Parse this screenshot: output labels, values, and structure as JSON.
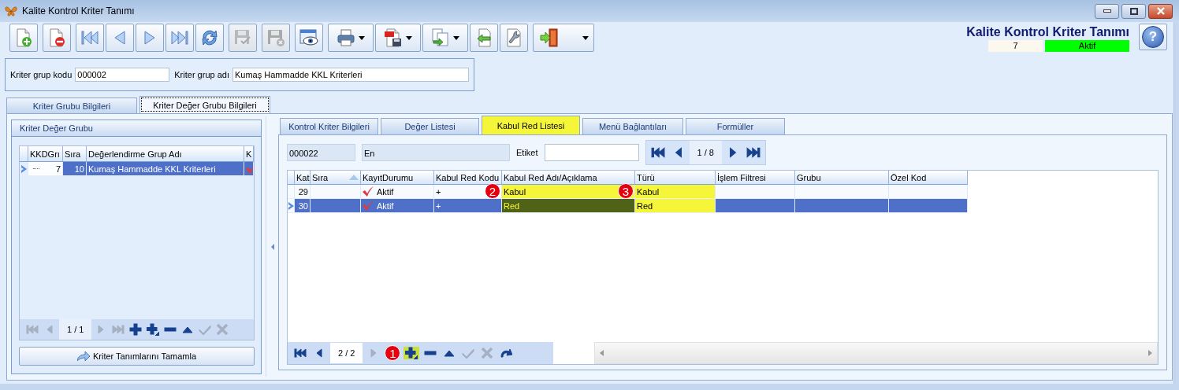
{
  "window": {
    "title": "Kalite Kontrol Kriter Tanımı"
  },
  "toolbar": [
    [
      {
        "kind": "new",
        "disabled": false,
        "has_menu": false
      }
    ],
    [
      {
        "kind": "delete",
        "disabled": false,
        "has_menu": false
      }
    ],
    [
      {
        "kind": "first",
        "disabled": false,
        "has_menu": false
      },
      {
        "kind": "prev",
        "disabled": false,
        "has_menu": false
      },
      {
        "kind": "next",
        "disabled": false,
        "has_menu": false
      },
      {
        "kind": "last",
        "disabled": false,
        "has_menu": false
      },
      {
        "kind": "refresh",
        "disabled": false,
        "has_menu": false
      }
    ],
    [
      {
        "kind": "save",
        "disabled": true,
        "has_menu": false
      }
    ],
    [
      {
        "kind": "cancel",
        "disabled": true,
        "has_menu": false
      }
    ],
    [
      {
        "kind": "preview",
        "disabled": false,
        "has_menu": false
      }
    ],
    [
      {
        "kind": "print",
        "disabled": false,
        "has_menu": true
      },
      {
        "kind": "pdf",
        "disabled": false,
        "has_menu": true
      },
      {
        "kind": "export",
        "disabled": false,
        "has_menu": true
      },
      {
        "kind": "import",
        "disabled": false,
        "has_menu": false
      },
      {
        "kind": "settings",
        "disabled": false,
        "has_menu": false
      }
    ],
    [
      {
        "kind": "exit",
        "disabled": false,
        "has_menu": true
      }
    ]
  ],
  "header": {
    "title": "Kalite Kontrol Kriter Tanımı",
    "record_no": "7",
    "status": "Aktif",
    "help_label": "?"
  },
  "form": [
    {
      "label": "Kriter grup kodu",
      "value": "000002"
    },
    {
      "label": "Kriter grup adı",
      "value": "Kumaş Hammadde KKL Kriterleri"
    }
  ],
  "main_tabs": [
    {
      "label": "Kriter Grubu Bilgileri",
      "selected": false
    },
    {
      "label": "Kriter Değer Grubu Bilgileri",
      "selected": true
    }
  ],
  "left_panel": {
    "title": "Kriter Değer Grubu",
    "grid": {
      "columns": [
        {
          "label": "KKDGrı"
        },
        {
          "label": "Sıra"
        },
        {
          "label": "Değerlendirme Grup Adı"
        },
        {
          "label": "K"
        }
      ],
      "rows": [
        {
          "selected": true,
          "cells": [
            {
              "text": "7",
              "kind": "lookup",
              "focused": true
            },
            {
              "text": "10",
              "kind": "number"
            },
            {
              "text": "Kumaş Hammadde KKL Kriterleri"
            },
            {
              "kind": "status",
              "checked": true
            }
          ]
        }
      ]
    },
    "navigator": {
      "position": "1 / 1",
      "buttons": [
        {
          "kind": "first",
          "disabled": true
        },
        {
          "kind": "prev",
          "disabled": true
        },
        {
          "kind": "pos"
        },
        {
          "kind": "next",
          "disabled": true
        },
        {
          "kind": "last",
          "disabled": true
        },
        {
          "kind": "add",
          "disabled": false
        },
        {
          "kind": "add-child",
          "disabled": false
        },
        {
          "kind": "remove",
          "disabled": false
        },
        {
          "kind": "up",
          "disabled": false
        },
        {
          "kind": "check",
          "disabled": true
        },
        {
          "kind": "cancel",
          "disabled": true
        }
      ]
    },
    "button": "Kriter Tanımlarını Tamamla"
  },
  "sub_tabs": [
    {
      "label": "Kontrol Kriter Bilgileri",
      "selected": false
    },
    {
      "label": "Değer Listesi",
      "selected": false
    },
    {
      "label": "Kabul Red Listesi",
      "selected": true
    },
    {
      "label": "Menü Bağlantıları",
      "selected": false
    },
    {
      "label": "Formüller",
      "selected": false
    }
  ],
  "detail": {
    "code": "000022",
    "name": "En",
    "tag_label": "Etiket",
    "record_position": "1 / 8",
    "grid": {
      "columns": [
        {
          "label": "Kat"
        },
        {
          "label": "Sıra",
          "sorted_ascending": true
        },
        {
          "label": "KayıtDurumu"
        },
        {
          "label": "Kabul Red Kodu"
        },
        {
          "label": "Kabul Red Adı/Açıklama"
        },
        {
          "label": "Türü"
        },
        {
          "label": "İşlem Filtresi"
        },
        {
          "label": "Grubu"
        },
        {
          "label": "Özel Kod"
        }
      ],
      "rows": [
        {
          "selected": false,
          "cells": [
            {
              "text": "29",
              "kind": "number"
            },
            {},
            {
              "text": "Aktif",
              "kind": "status",
              "checked": true
            },
            {
              "text": "+",
              "callout": "2"
            },
            {
              "text": "Kabul",
              "highlight": true,
              "callout": "3"
            },
            {
              "text": "Kabul",
              "highlight": true
            },
            {},
            {},
            {}
          ]
        },
        {
          "selected": true,
          "cells": [
            {
              "text": "30",
              "kind": "number"
            },
            {},
            {
              "text": "Aktif",
              "kind": "status",
              "checked": true
            },
            {
              "text": "+"
            },
            {
              "text": "Red",
              "highlight": true,
              "focused": true
            },
            {
              "text": "Red",
              "highlight": true
            },
            {},
            {},
            {}
          ]
        }
      ]
    },
    "navigator": {
      "position": "2 / 2",
      "buttons": [
        {
          "kind": "first",
          "disabled": false
        },
        {
          "kind": "prev",
          "disabled": false
        },
        {
          "kind": "pos"
        },
        {
          "kind": "next",
          "disabled": true
        },
        {
          "kind": "add-child",
          "disabled": false,
          "highlight": true,
          "callout": "1"
        },
        {
          "kind": "remove",
          "disabled": false
        },
        {
          "kind": "up",
          "disabled": false
        },
        {
          "kind": "check",
          "disabled": true
        },
        {
          "kind": "cancel",
          "disabled": true
        },
        {
          "kind": "redo",
          "disabled": false
        }
      ]
    }
  }
}
